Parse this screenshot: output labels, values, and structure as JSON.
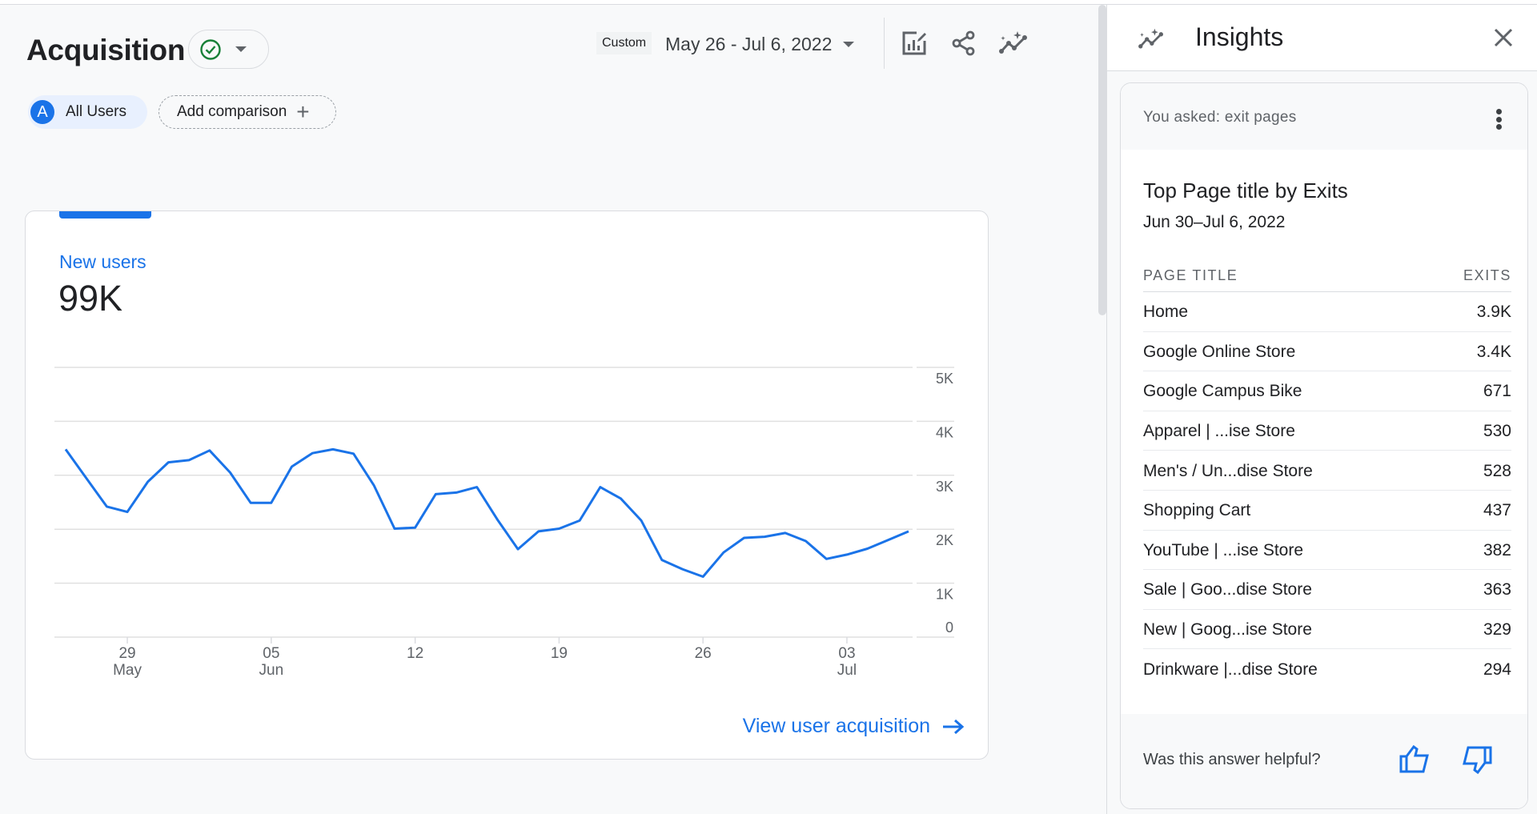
{
  "header": {
    "title": "Acquisition",
    "status_icon": "check-circle-icon",
    "date_badge": "Custom",
    "date_range": "May 26 - Jul 6, 2022",
    "tools": [
      "customize-report-icon",
      "share-icon",
      "insights-icon"
    ]
  },
  "comparison": {
    "segment_avatar": "A",
    "segment_label": "All Users",
    "add_label": "Add comparison"
  },
  "card": {
    "metric_label": "New users",
    "metric_value": "99K",
    "link_label": "View user acquisition"
  },
  "chart_data": {
    "type": "line",
    "title": "New users",
    "xlabel": "",
    "ylabel": "",
    "x_start": "2022-05-26",
    "x_end": "2022-07-06",
    "x_ticks": [
      {
        "day": "29",
        "month": "May",
        "index": 3
      },
      {
        "day": "05",
        "month": "Jun",
        "index": 10
      },
      {
        "day": "12",
        "month": "",
        "index": 17
      },
      {
        "day": "19",
        "month": "",
        "index": 24
      },
      {
        "day": "26",
        "month": "",
        "index": 31
      },
      {
        "day": "03",
        "month": "Jul",
        "index": 38
      }
    ],
    "y_ticks": [
      "0",
      "1K",
      "2K",
      "3K",
      "4K",
      "5K"
    ],
    "ylim": [
      0,
      5000
    ],
    "grid": true,
    "series": [
      {
        "name": "New users",
        "color": "#1a73e8",
        "values": [
          3480,
          2950,
          2420,
          2320,
          2880,
          3240,
          3280,
          3460,
          3050,
          2490,
          2490,
          3160,
          3410,
          3480,
          3400,
          2810,
          2010,
          2030,
          2650,
          2680,
          2780,
          2180,
          1630,
          1960,
          2010,
          2160,
          2780,
          2570,
          2160,
          1430,
          1260,
          1120,
          1570,
          1840,
          1860,
          1930,
          1780,
          1450,
          1530,
          1640,
          1800,
          1960
        ]
      }
    ]
  },
  "insights": {
    "title": "Insights",
    "asked": "You asked: exit pages",
    "answer_title": "Top Page title by Exits",
    "answer_date": "Jun 30–Jul 6, 2022",
    "columns": [
      "PAGE TITLE",
      "EXITS"
    ],
    "rows": [
      {
        "title": "Home",
        "exits": "3.9K"
      },
      {
        "title": "Google Online Store",
        "exits": "3.4K"
      },
      {
        "title": "Google Campus Bike",
        "exits": "671"
      },
      {
        "title": "Apparel | ...ise Store",
        "exits": "530"
      },
      {
        "title": "Men's / Un...dise Store",
        "exits": "528"
      },
      {
        "title": "Shopping Cart",
        "exits": "437"
      },
      {
        "title": "YouTube | ...ise Store",
        "exits": "382"
      },
      {
        "title": "Sale | Goo...dise Store",
        "exits": "363"
      },
      {
        "title": "New | Goog...ise Store",
        "exits": "329"
      },
      {
        "title": "Drinkware |...dise Store",
        "exits": "294"
      }
    ],
    "feedback_question": "Was this answer helpful?"
  },
  "colors": {
    "accent": "#1a73e8",
    "success": "#188038",
    "icon": "#5f6368"
  }
}
